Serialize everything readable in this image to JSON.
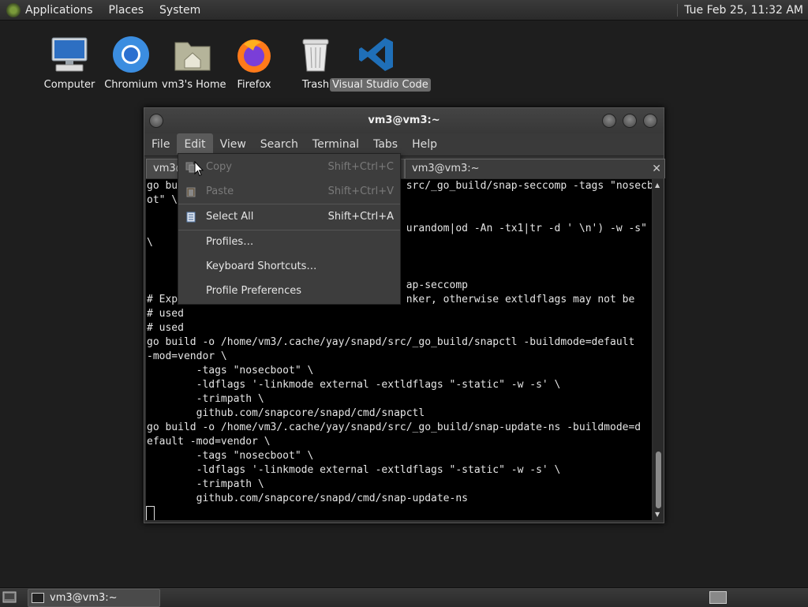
{
  "top_panel": {
    "menus": [
      "Applications",
      "Places",
      "System"
    ],
    "clock": "Tue Feb 25, 11:32 AM"
  },
  "desktop_icons": [
    {
      "label": "Computer",
      "icon": "computer-icon"
    },
    {
      "label": "Chromium",
      "icon": "chromium-icon"
    },
    {
      "label": "vm3's Home",
      "icon": "home-folder-icon"
    },
    {
      "label": "Firefox",
      "icon": "firefox-icon"
    },
    {
      "label": "Trash",
      "icon": "trash-icon"
    },
    {
      "label": "Visual Studio Code",
      "icon": "vscode-icon",
      "selected": true
    }
  ],
  "terminal_window": {
    "title": "vm3@vm3:~",
    "menus": [
      "File",
      "Edit",
      "View",
      "Search",
      "Terminal",
      "Tabs",
      "Help"
    ],
    "active_menu": "Edit",
    "tabs": [
      {
        "label": "vm3@",
        "active": true
      },
      {
        "label": "vm3@vm3:~",
        "active": false
      }
    ],
    "lines": [
      "go bui                                    src/_go_build/snap-seccomp -tags \"nosecbo",
      "ot\" \\",
      "",
      "                                          urandom|od -An -tx1|tr -d ' \\n') -w -s\"",
      "\\",
      "",
      "",
      "                                          ap-seccomp",
      "# Exp                                     nker, otherwise extldflags may not be",
      "# used",
      "# used",
      "go build -o /home/vm3/.cache/yay/snapd/src/_go_build/snapctl -buildmode=default",
      "-mod=vendor \\",
      "        -tags \"nosecboot\" \\",
      "        -ldflags '-linkmode external -extldflags \"-static\" -w -s' \\",
      "        -trimpath \\",
      "        github.com/snapcore/snapd/cmd/snapctl",
      "go build -o /home/vm3/.cache/yay/snapd/src/_go_build/snap-update-ns -buildmode=d",
      "efault -mod=vendor \\",
      "        -tags \"nosecboot\" \\",
      "        -ldflags '-linkmode external -extldflags \"-static\" -w -s' \\",
      "        -trimpath \\",
      "        github.com/snapcore/snapd/cmd/snap-update-ns"
    ]
  },
  "edit_menu": {
    "items": [
      {
        "label": "Copy",
        "shortcut": "Shift+Ctrl+C",
        "icon": "copy-icon",
        "enabled": false
      },
      {
        "label": "Paste",
        "shortcut": "Shift+Ctrl+V",
        "icon": "paste-icon",
        "enabled": false
      },
      {
        "label": "Select All",
        "shortcut": "Shift+Ctrl+A",
        "icon": "select-all-icon",
        "enabled": true
      },
      {
        "label": "Profiles…",
        "shortcut": "",
        "enabled": true
      },
      {
        "label": "Keyboard Shortcuts…",
        "shortcut": "",
        "enabled": true
      },
      {
        "label": "Profile Preferences",
        "shortcut": "",
        "enabled": true
      }
    ]
  },
  "bottom_panel": {
    "task_label": "vm3@vm3:~"
  },
  "colors": {
    "desktop_bg": "#1e1e1e",
    "panel_bg": "#2e2e2e",
    "terminal_bg": "#000000",
    "menu_bg": "#3d3d3d",
    "selection": "#6a6a6a",
    "vscode_blue": "#1f6fb8"
  }
}
